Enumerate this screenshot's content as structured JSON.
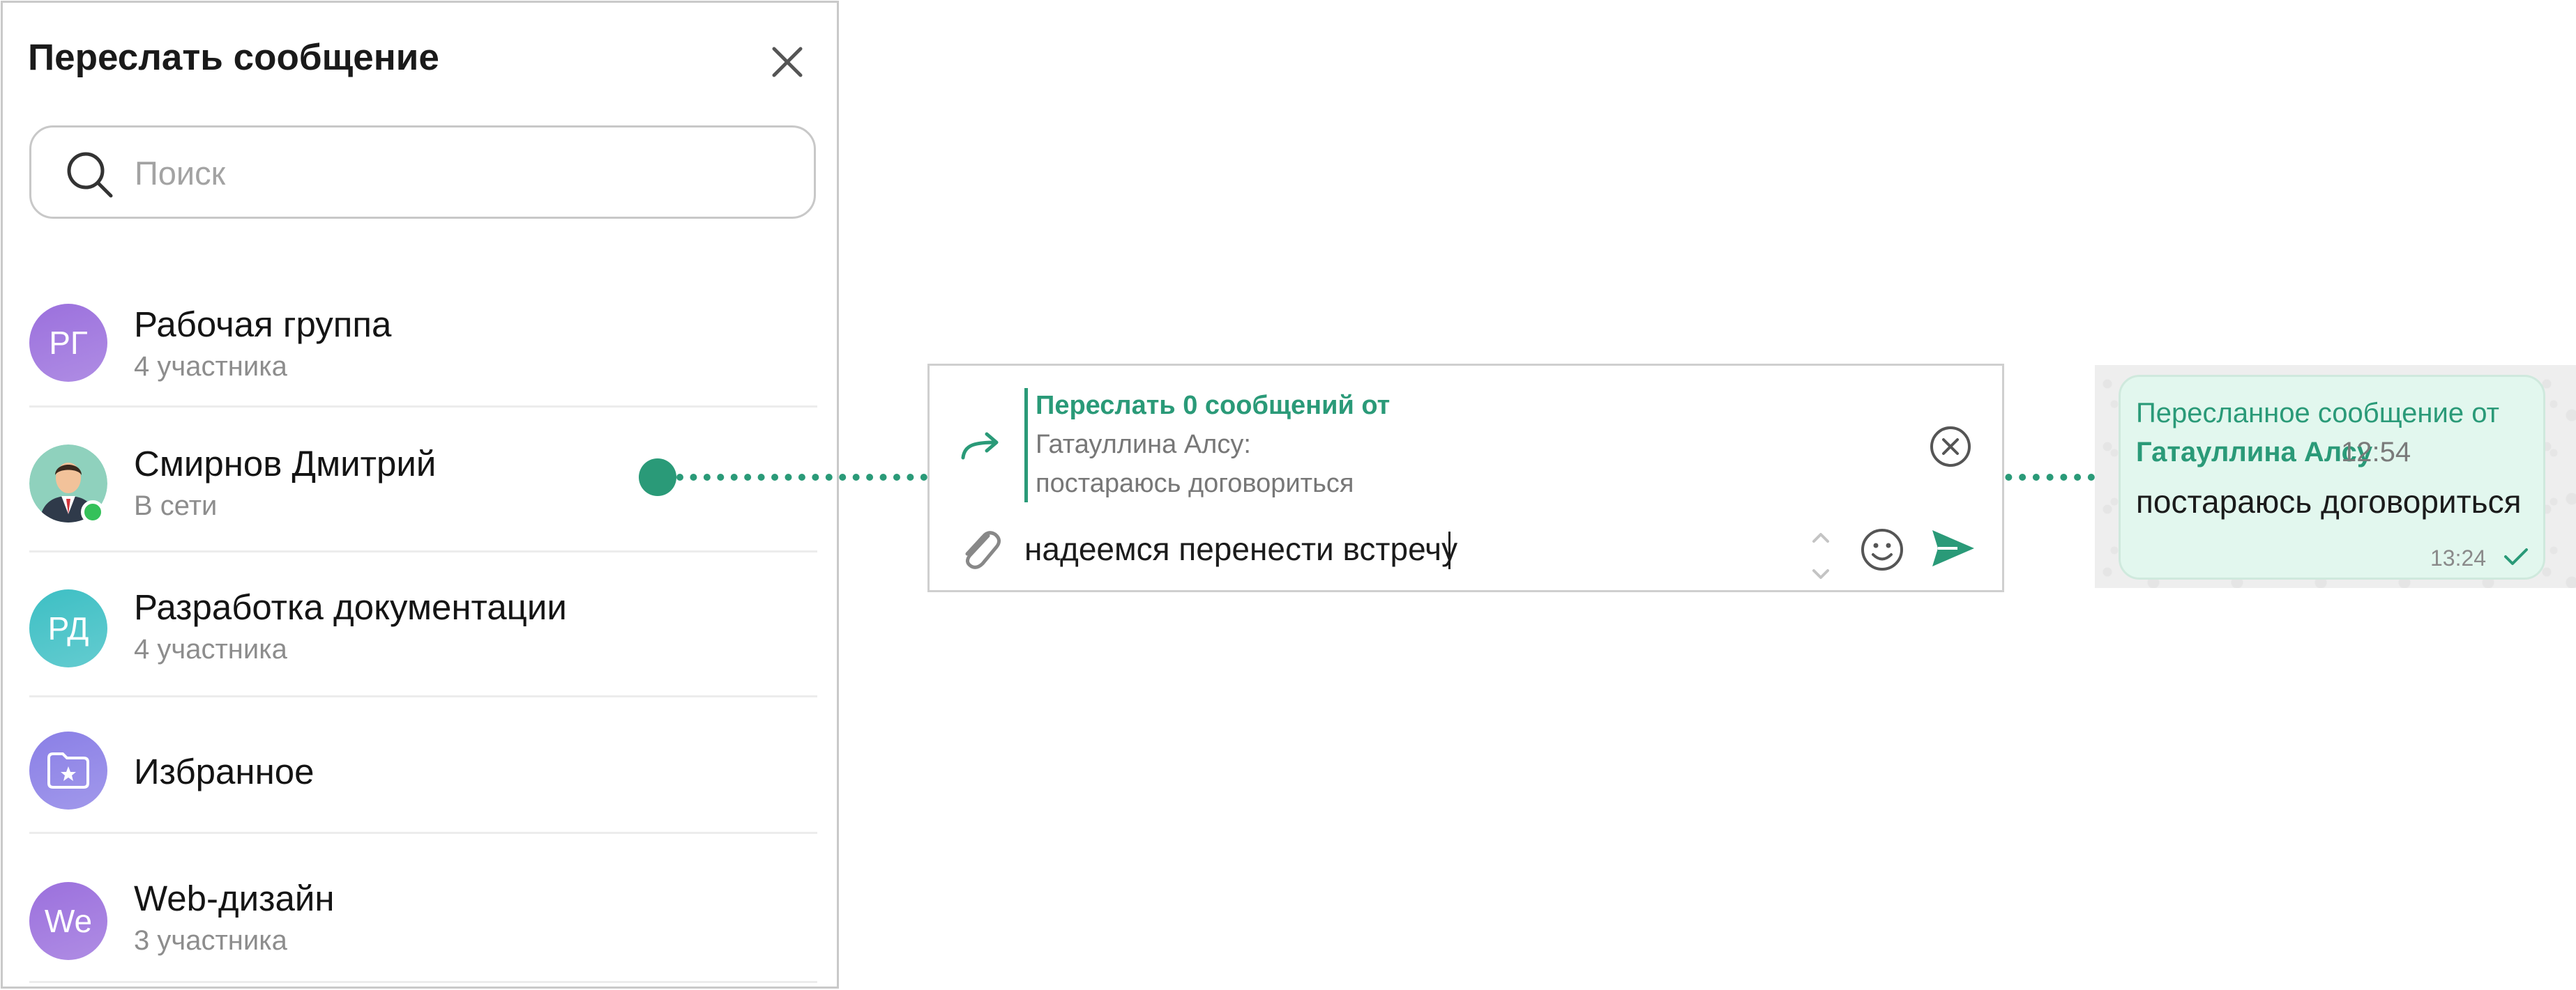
{
  "dialog": {
    "title": "Переслать сообщение",
    "search_placeholder": "Поиск",
    "chats": [
      {
        "name": "Рабочая группа",
        "subtitle": "4 участника",
        "avatar_text": "РГ",
        "avatar_color": "#9b70dd"
      },
      {
        "name": "Смирнов Дмитрий",
        "subtitle": "В сети",
        "avatar_text": "",
        "avatar_color": "#7fc8b2",
        "online": true
      },
      {
        "name": "Разработка документации",
        "subtitle": "4 участника",
        "avatar_text": "РД",
        "avatar_color": "#3dbfc4"
      },
      {
        "name": "Избранное",
        "subtitle": "",
        "avatar_text": "",
        "avatar_color": "#8a7fe6",
        "icon": "folder-star-icon"
      },
      {
        "name": "Web-дизайн",
        "subtitle": "3 участника",
        "avatar_text": "We",
        "avatar_color": "#9b70dd"
      }
    ]
  },
  "composer": {
    "forward_title": "Переслать 0 сообщений от",
    "forward_author": "Гатауллина Алсу:",
    "forward_text": "постараюсь договориться",
    "input_value": "надеемся перенести встречу"
  },
  "bubble": {
    "forwarded_label": "Пересланное сообщение от",
    "author": "Гатауллина Алсу",
    "original_time": "12:54",
    "text": "постараюсь договориться",
    "time": "13:24"
  },
  "colors": {
    "accent": "#2a9a78",
    "bubble_bg": "#e2f7ee",
    "online": "#35c15a"
  }
}
